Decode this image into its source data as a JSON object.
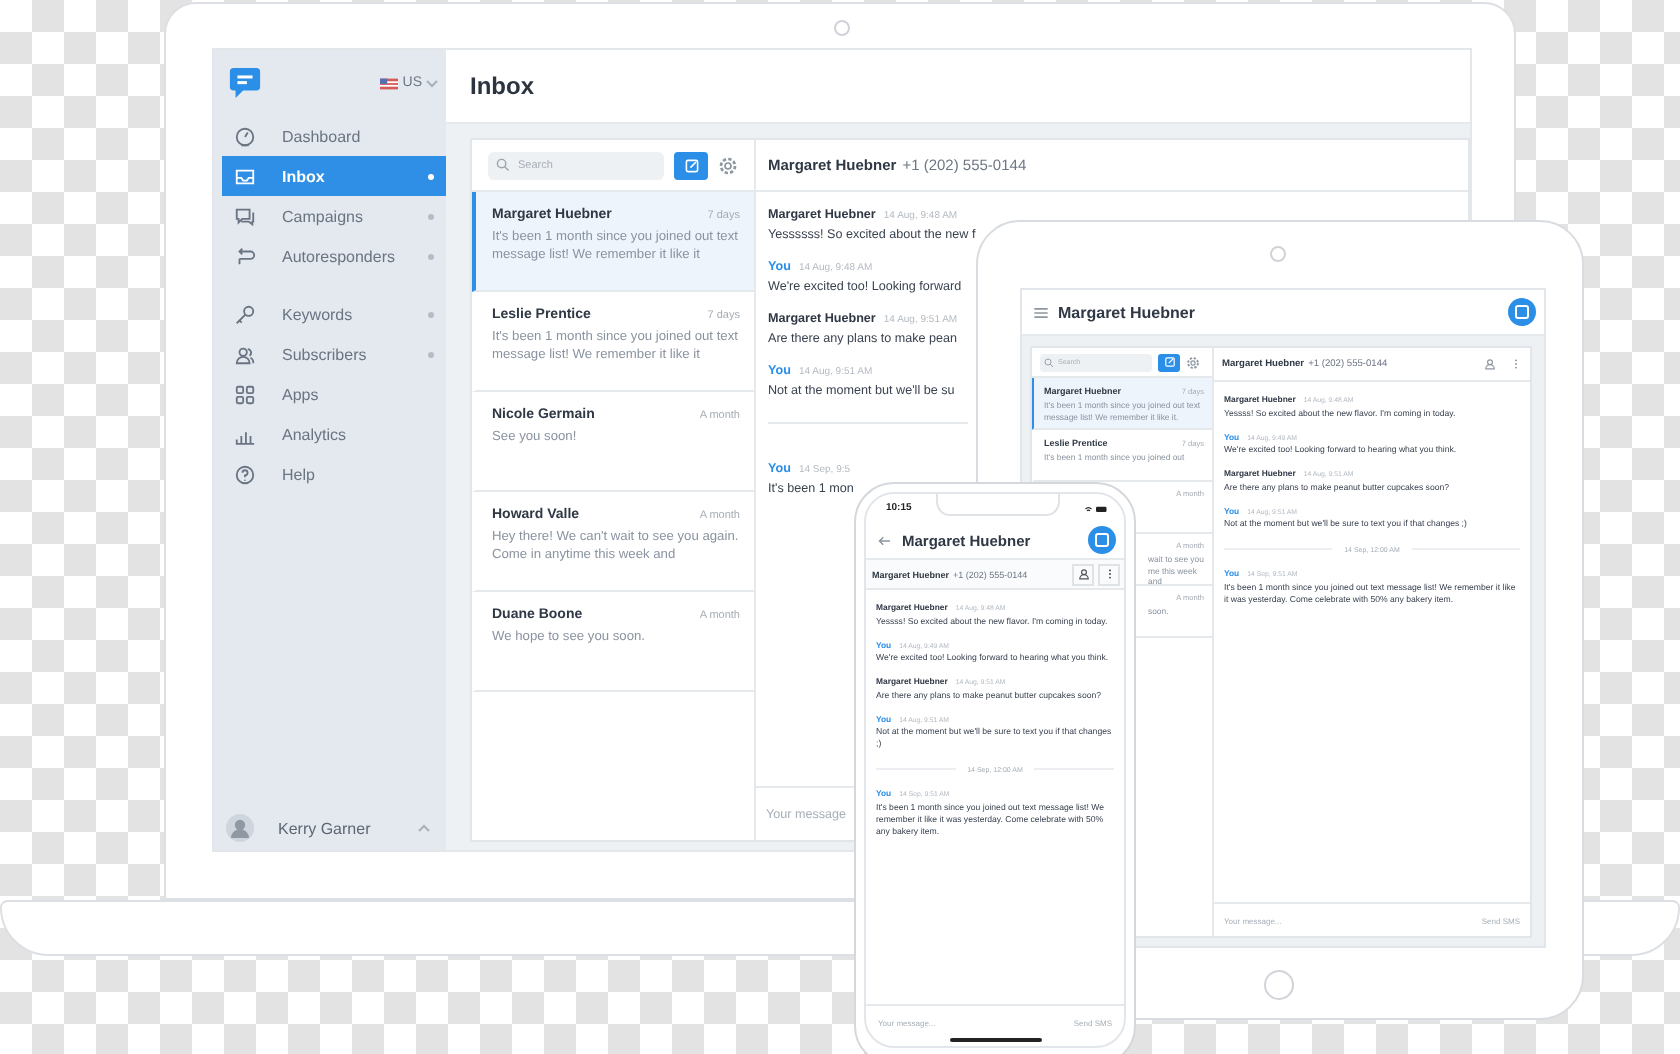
{
  "laptop": {
    "sidebar": {
      "region": "US",
      "nav_groups": [
        [
          {
            "label": "Dashboard",
            "selected": false,
            "expandable": false
          },
          {
            "label": "Inbox",
            "selected": true,
            "expandable": true
          },
          {
            "label": "Campaigns",
            "selected": false,
            "expandable": true
          },
          {
            "label": "Autoresponders",
            "selected": false,
            "expandable": true
          }
        ],
        [
          {
            "label": "Keywords",
            "selected": false,
            "expandable": true
          },
          {
            "label": "Subscribers",
            "selected": false,
            "expandable": true
          },
          {
            "label": "Apps",
            "selected": false,
            "expandable": false
          },
          {
            "label": "Analytics",
            "selected": false,
            "expandable": false
          },
          {
            "label": "Help",
            "selected": false,
            "expandable": false
          }
        ]
      ],
      "user": "Kerry Garner"
    },
    "title": "Inbox",
    "search_placeholder": "Search",
    "conversations": [
      {
        "name": "Margaret Huebner",
        "date": "7 days",
        "preview": "It's been 1 month since you joined out text message list! We remember it like it",
        "selected": true
      },
      {
        "name": "Leslie Prentice",
        "date": "7 days",
        "preview": "It's been 1 month since you joined out text message list! We remember it like it",
        "selected": false
      },
      {
        "name": "Nicole Germain",
        "date": "A month",
        "preview": "See you soon!",
        "selected": false
      },
      {
        "name": "Howard Valle",
        "date": "A month",
        "preview": "Hey there! We can't wait to see you again. Come in anytime this week and",
        "selected": false
      },
      {
        "name": "Duane Boone",
        "date": "A month",
        "preview": "We hope to see you soon.",
        "selected": false
      }
    ],
    "chat": {
      "contact": "Margaret Huebner",
      "phone": "+1 (202) 555-0144",
      "messages": [
        {
          "kind": "message",
          "sender": "Margaret Huebner",
          "own": false,
          "time": "14 Aug, 9:48 AM",
          "text": "Yessssss! So excited about the new f"
        },
        {
          "kind": "message",
          "sender": "You",
          "own": true,
          "time": "14 Aug, 9:48 AM",
          "text": "We're excited too! Looking forward"
        },
        {
          "kind": "message",
          "sender": "Margaret Huebner",
          "own": false,
          "time": "14 Aug, 9:51 AM",
          "text": "Are there any plans to make pean"
        },
        {
          "kind": "message",
          "sender": "You",
          "own": true,
          "time": "14 Aug, 9:51 AM",
          "text": "Not at the moment but we'll be su"
        },
        {
          "kind": "divider"
        },
        {
          "kind": "message",
          "sender": "You",
          "own": true,
          "time": "14 Sep, 9:5",
          "text": "It's been 1 mon"
        }
      ],
      "placeholder": "Your message"
    }
  },
  "tablet": {
    "title": "Margaret Huebner",
    "search_placeholder": "Search",
    "conversations": [
      {
        "name": "Margaret Huebner",
        "date": "7 days",
        "preview": "It's been 1 month since you joined out text message list! We remember it like it.",
        "selected": true
      },
      {
        "name": "Leslie Prentice",
        "date": "7 days",
        "preview": "It's been 1 month since you joined out",
        "selected": false
      }
    ],
    "covered_conversations": [
      {
        "date": "A month"
      },
      {
        "date": "A month",
        "preview": "wait to see you me this week and"
      },
      {
        "date": "A month",
        "preview": "soon."
      }
    ],
    "chat": {
      "contact": "Margaret Huebner",
      "phone": "+1 (202) 555-0144",
      "messages": [
        {
          "kind": "message",
          "sender": "Margaret Huebner",
          "own": false,
          "time": "14 Aug, 9:48 AM",
          "text": "Yessss! So excited about the new flavor. I'm coming in today."
        },
        {
          "kind": "message",
          "sender": "You",
          "own": true,
          "time": "14 Aug, 9:49 AM",
          "text": "We're excited too! Looking forward to hearing what you think."
        },
        {
          "kind": "message",
          "sender": "Margaret Huebner",
          "own": false,
          "time": "14 Aug, 9:51 AM",
          "text": "Are there any plans to make peanut butter cupcakes soon?"
        },
        {
          "kind": "message",
          "sender": "You",
          "own": true,
          "time": "14 Aug, 9:51 AM",
          "text": "Not at the moment but we'll be sure to text you if that changes ;)"
        },
        {
          "kind": "divider",
          "label": "14 Sep, 12:00 AM"
        },
        {
          "kind": "message",
          "sender": "You",
          "own": true,
          "time": "14 Sep, 9:51 AM",
          "text": "It's been 1 month since you joined out text message list! We remember it like it was yesterday. Come celebrate with 50% any bakery item."
        }
      ],
      "placeholder": "Your message...",
      "send": "Send SMS"
    }
  },
  "phone": {
    "clock": "10:15",
    "title": "Margaret Huebner",
    "chat": {
      "contact": "Margaret Huebner",
      "phone": "+1 (202) 555-0144",
      "messages": [
        {
          "kind": "message",
          "sender": "Margaret Huebner",
          "own": false,
          "time": "14 Aug, 9:48 AM",
          "text": "Yessss! So excited about the new flavor. I'm coming in today."
        },
        {
          "kind": "message",
          "sender": "You",
          "own": true,
          "time": "14 Aug, 9:49 AM",
          "text": "We're excited too! Looking forward to hearing what you think."
        },
        {
          "kind": "message",
          "sender": "Margaret Huebner",
          "own": false,
          "time": "14 Aug, 9:51 AM",
          "text": "Are there any plans to make peanut butter cupcakes soon?"
        },
        {
          "kind": "message",
          "sender": "You",
          "own": true,
          "time": "14 Aug, 9:51 AM",
          "text": "Not at the moment but we'll be sure to text you if that changes ;)"
        },
        {
          "kind": "divider",
          "label": "14 Sep, 12:00 AM"
        },
        {
          "kind": "message",
          "sender": "You",
          "own": true,
          "time": "14 Sep, 9:51 AM",
          "text": "It's been 1 month since you joined out text message list! We remember it like it was yesterday. Come celebrate with 50% any bakery item."
        }
      ],
      "placeholder": "Your message...",
      "send": "Send SMS"
    }
  }
}
